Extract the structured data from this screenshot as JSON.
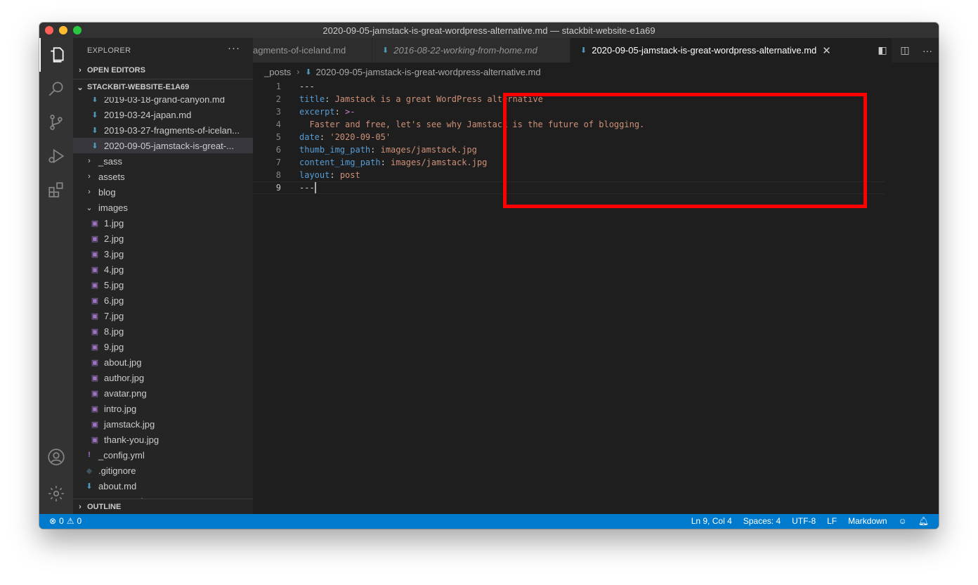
{
  "window": {
    "title": "2020-09-05-jamstack-is-great-wordpress-alternative.md — stackbit-website-e1a69"
  },
  "activity_bar": {
    "icons": [
      "files-icon",
      "search-icon",
      "source-control-icon",
      "run-debug-icon",
      "extensions-icon",
      "account-icon",
      "settings-gear-icon"
    ]
  },
  "sidebar": {
    "title": "EXPLORER",
    "more": "···",
    "open_editors_label": "OPEN EDITORS",
    "project_label": "STACKBIT-WEBSITE-E1A69",
    "outline_label": "OUTLINE",
    "items": [
      {
        "label": "2019-03-18-grand-canyon.md",
        "icon": "markdown-icon",
        "indent": 24
      },
      {
        "label": "2019-03-24-japan.md",
        "icon": "markdown-icon",
        "indent": 24
      },
      {
        "label": "2019-03-27-fragments-of-icelan...",
        "icon": "markdown-icon",
        "indent": 24
      },
      {
        "label": "2020-09-05-jamstack-is-great-...",
        "icon": "markdown-icon",
        "indent": 24,
        "selected": true
      },
      {
        "label": "_sass",
        "icon": "chevron-right-icon",
        "indent": 16
      },
      {
        "label": "assets",
        "icon": "chevron-right-icon",
        "indent": 16
      },
      {
        "label": "blog",
        "icon": "chevron-right-icon",
        "indent": 16
      },
      {
        "label": "images",
        "icon": "chevron-down-icon",
        "indent": 16
      },
      {
        "label": "1.jpg",
        "icon": "image-icon",
        "indent": 24
      },
      {
        "label": "2.jpg",
        "icon": "image-icon",
        "indent": 24
      },
      {
        "label": "3.jpg",
        "icon": "image-icon",
        "indent": 24
      },
      {
        "label": "4.jpg",
        "icon": "image-icon",
        "indent": 24
      },
      {
        "label": "5.jpg",
        "icon": "image-icon",
        "indent": 24
      },
      {
        "label": "6.jpg",
        "icon": "image-icon",
        "indent": 24
      },
      {
        "label": "7.jpg",
        "icon": "image-icon",
        "indent": 24
      },
      {
        "label": "8.jpg",
        "icon": "image-icon",
        "indent": 24
      },
      {
        "label": "9.jpg",
        "icon": "image-icon",
        "indent": 24
      },
      {
        "label": "about.jpg",
        "icon": "image-icon",
        "indent": 24
      },
      {
        "label": "author.jpg",
        "icon": "image-icon",
        "indent": 24
      },
      {
        "label": "avatar.png",
        "icon": "image-icon",
        "indent": 24
      },
      {
        "label": "intro.jpg",
        "icon": "image-icon",
        "indent": 24
      },
      {
        "label": "jamstack.jpg",
        "icon": "image-icon",
        "indent": 24
      },
      {
        "label": "thank-you.jpg",
        "icon": "image-icon",
        "indent": 24
      },
      {
        "label": "_config.yml",
        "icon": "yaml-icon",
        "indent": 16
      },
      {
        "label": ".gitignore",
        "icon": "git-icon",
        "indent": 16
      },
      {
        "label": "about.md",
        "icon": "markdown-icon",
        "indent": 16
      },
      {
        "label": "contact.md",
        "icon": "markdown-icon",
        "indent": 16
      }
    ]
  },
  "tabs": [
    {
      "label": "agments-of-iceland.md",
      "active": false,
      "italic": false
    },
    {
      "label": "2016-08-22-working-from-home.md",
      "active": false,
      "italic": true
    },
    {
      "label": "2020-09-05-jamstack-is-great-wordpress-alternative.md",
      "active": true,
      "italic": false
    }
  ],
  "tab_actions": [
    "open-preview-icon",
    "split-editor-icon",
    "more-actions-icon"
  ],
  "breadcrumb": {
    "folder": "_posts",
    "file": "2020-09-05-jamstack-is-great-wordpress-alternative.md"
  },
  "code_lines": [
    {
      "n": "1",
      "tokens": [
        {
          "t": "---",
          "c": "dash"
        }
      ]
    },
    {
      "n": "2",
      "tokens": [
        {
          "t": "title",
          "c": "key"
        },
        {
          "t": ": ",
          "c": "punc"
        },
        {
          "t": "Jamstack is a great WordPress alternative",
          "c": "str"
        }
      ]
    },
    {
      "n": "3",
      "tokens": [
        {
          "t": "excerpt",
          "c": "key"
        },
        {
          "t": ": ",
          "c": "punc"
        },
        {
          "t": ">-",
          "c": "op"
        }
      ]
    },
    {
      "n": "4",
      "tokens": [
        {
          "t": "  Faster and free, let's see why Jamstack is the future of blogging.",
          "c": "str"
        }
      ]
    },
    {
      "n": "5",
      "tokens": [
        {
          "t": "date",
          "c": "key"
        },
        {
          "t": ": ",
          "c": "punc"
        },
        {
          "t": "'2020-09-05'",
          "c": "str"
        }
      ]
    },
    {
      "n": "6",
      "tokens": [
        {
          "t": "thumb_img_path",
          "c": "key"
        },
        {
          "t": ": ",
          "c": "punc"
        },
        {
          "t": "images/jamstack.jpg",
          "c": "str"
        }
      ]
    },
    {
      "n": "7",
      "tokens": [
        {
          "t": "content_img_path",
          "c": "key"
        },
        {
          "t": ": ",
          "c": "punc"
        },
        {
          "t": "images/jamstack.jpg",
          "c": "str"
        }
      ]
    },
    {
      "n": "8",
      "tokens": [
        {
          "t": "layout",
          "c": "key"
        },
        {
          "t": ": ",
          "c": "punc"
        },
        {
          "t": "post",
          "c": "str"
        }
      ]
    },
    {
      "n": "9",
      "tokens": [
        {
          "t": "---",
          "c": "dash"
        }
      ],
      "current": true
    }
  ],
  "status_bar": {
    "errors": "0",
    "warnings": "0",
    "position": "Ln 9, Col 4",
    "spaces": "Spaces: 4",
    "encoding": "UTF-8",
    "eol": "LF",
    "language": "Markdown"
  },
  "colors": {
    "highlight_box": "#ff0000",
    "status_bar": "#007acc",
    "yaml_key": "#569cd6",
    "yaml_string": "#ce9178"
  }
}
